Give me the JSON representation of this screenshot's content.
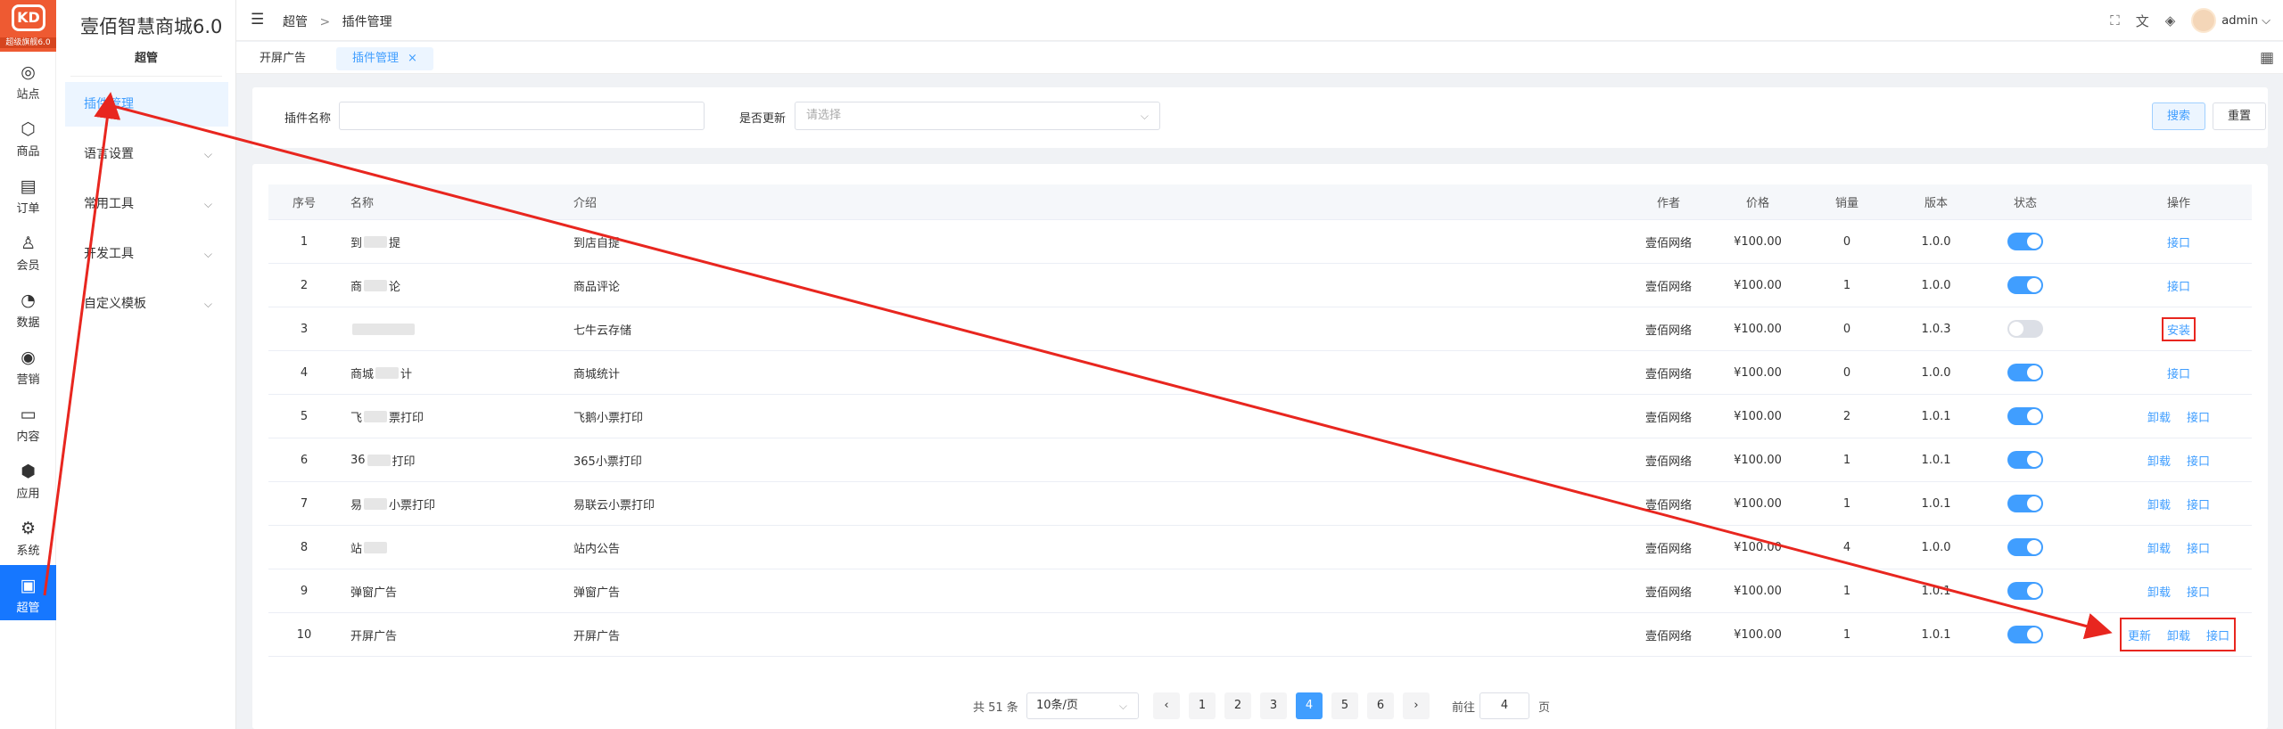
{
  "rail": {
    "logo_text": "KD",
    "version_label": "超级旗舰6.0",
    "items": [
      {
        "label": "站点",
        "icon": "globe-icon",
        "glyph": "◎"
      },
      {
        "label": "商品",
        "icon": "box-icon",
        "glyph": "⬡"
      },
      {
        "label": "订单",
        "icon": "clipboard-icon",
        "glyph": "▤"
      },
      {
        "label": "会员",
        "icon": "user-icon",
        "glyph": "♙"
      },
      {
        "label": "数据",
        "icon": "pie-chart-icon",
        "glyph": "◔"
      },
      {
        "label": "营销",
        "icon": "target-icon",
        "glyph": "◉"
      },
      {
        "label": "内容",
        "icon": "folder-icon",
        "glyph": "▭"
      },
      {
        "label": "应用",
        "icon": "cube-icon",
        "glyph": "⬢"
      },
      {
        "label": "系统",
        "icon": "gear-icon",
        "glyph": "⚙"
      },
      {
        "label": "超管",
        "icon": "briefcase-icon",
        "glyph": "▣",
        "active": true
      }
    ]
  },
  "sidebar": {
    "brand": "壹佰智慧商城6.0",
    "section": "超管",
    "items": [
      {
        "label": "插件管理",
        "active": true,
        "expandable": false
      },
      {
        "label": "语言设置",
        "active": false,
        "expandable": true
      },
      {
        "label": "常用工具",
        "active": false,
        "expandable": true
      },
      {
        "label": "开发工具",
        "active": false,
        "expandable": true
      },
      {
        "label": "自定义模板",
        "active": false,
        "expandable": true
      }
    ]
  },
  "header": {
    "breadcrumb": [
      "超管",
      "插件管理"
    ],
    "breadcrumb_sep": ">",
    "user": "admin"
  },
  "tabs": [
    {
      "label": "开屏广告",
      "active": false
    },
    {
      "label": "插件管理",
      "active": true,
      "closable": true
    }
  ],
  "search": {
    "name_label": "插件名称",
    "name_value": "",
    "update_label": "是否更新",
    "update_placeholder": "请选择",
    "search_button": "搜索",
    "reset_button": "重置"
  },
  "table": {
    "columns": {
      "no": "序号",
      "name": "名称",
      "desc": "介绍",
      "author": "作者",
      "price": "价格",
      "sales": "销量",
      "version": "版本",
      "status": "状态",
      "ops": "操作"
    },
    "rows": [
      {
        "no": "1",
        "name_pre": "到",
        "name_post": "提",
        "desc": "到店自提",
        "author": "壹佰网络",
        "price": "¥100.00",
        "sales": "0",
        "version": "1.0.0",
        "status": true,
        "ops": [
          "接口"
        ]
      },
      {
        "no": "2",
        "name_pre": "商",
        "name_post": "论",
        "desc": "商品评论",
        "author": "壹佰网络",
        "price": "¥100.00",
        "sales": "1",
        "version": "1.0.0",
        "status": true,
        "ops": [
          "接口"
        ]
      },
      {
        "no": "3",
        "name_pre": "",
        "name_post": "",
        "desc": "七牛云存储",
        "author": "壹佰网络",
        "price": "¥100.00",
        "sales": "0",
        "version": "1.0.3",
        "status": false,
        "ops": [
          "安装"
        ]
      },
      {
        "no": "4",
        "name_pre": "商城",
        "name_post": "计",
        "desc": "商城统计",
        "author": "壹佰网络",
        "price": "¥100.00",
        "sales": "0",
        "version": "1.0.0",
        "status": true,
        "ops": [
          "接口"
        ]
      },
      {
        "no": "5",
        "name_pre": "飞",
        "name_post": "票打印",
        "desc": "飞鹅小票打印",
        "author": "壹佰网络",
        "price": "¥100.00",
        "sales": "2",
        "version": "1.0.1",
        "status": true,
        "ops": [
          "卸载",
          "接口"
        ]
      },
      {
        "no": "6",
        "name_pre": "36",
        "name_post": "打印",
        "desc": "365小票打印",
        "author": "壹佰网络",
        "price": "¥100.00",
        "sales": "1",
        "version": "1.0.1",
        "status": true,
        "ops": [
          "卸载",
          "接口"
        ]
      },
      {
        "no": "7",
        "name_pre": "易",
        "name_post": "小票打印",
        "desc": "易联云小票打印",
        "author": "壹佰网络",
        "price": "¥100.00",
        "sales": "1",
        "version": "1.0.1",
        "status": true,
        "ops": [
          "卸载",
          "接口"
        ]
      },
      {
        "no": "8",
        "name_pre": "站",
        "name_post": "",
        "desc": "站内公告",
        "author": "壹佰网络",
        "price": "¥100.00",
        "sales": "4",
        "version": "1.0.0",
        "status": true,
        "ops": [
          "卸载",
          "接口"
        ]
      },
      {
        "no": "9",
        "name_pre": "弹窗广告",
        "name_post": "",
        "desc": "弹窗广告",
        "author": "壹佰网络",
        "price": "¥100.00",
        "sales": "1",
        "version": "1.0.1",
        "status": true,
        "ops": [
          "卸载",
          "接口"
        ]
      },
      {
        "no": "10",
        "name_pre": "开屏广告",
        "name_post": "",
        "desc": "开屏广告",
        "author": "壹佰网络",
        "price": "¥100.00",
        "sales": "1",
        "version": "1.0.1",
        "status": true,
        "ops": [
          "更新",
          "卸载",
          "接口"
        ]
      }
    ]
  },
  "pagination": {
    "total": "共 51 条",
    "page_size": "10条/页",
    "pages": [
      "1",
      "2",
      "3",
      "4",
      "5",
      "6"
    ],
    "current": "4",
    "prev": "‹",
    "next": "›",
    "goto_label": "前往",
    "goto_value": "4",
    "goto_unit": "页"
  },
  "colors": {
    "accent": "#409eff",
    "rail_active": "#1677ff",
    "logo_bg": "#ee5a32",
    "annotation": "#e8261f"
  }
}
